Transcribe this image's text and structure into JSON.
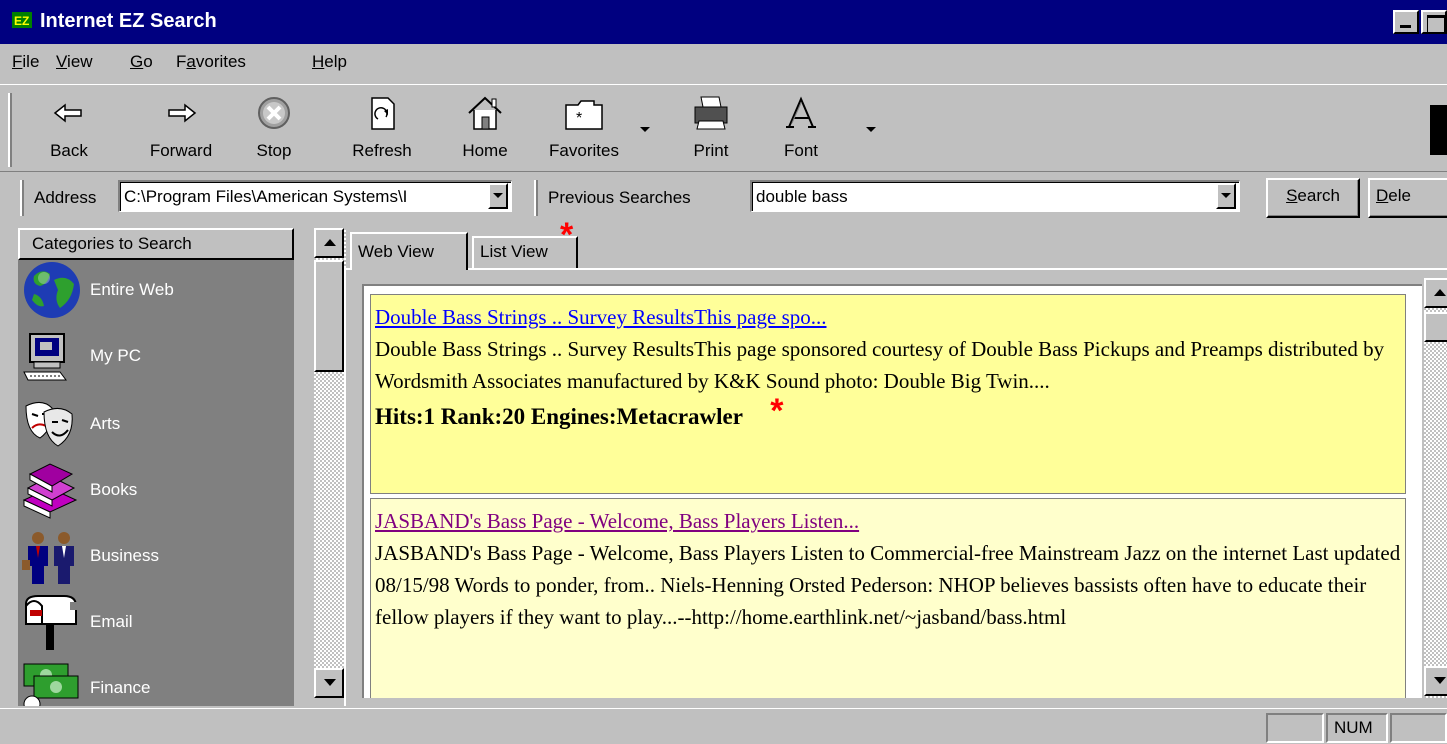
{
  "window": {
    "title": "Internet EZ Search",
    "icon": "ez-logo-icon"
  },
  "menu": {
    "items": [
      {
        "label": "File",
        "accel": "F"
      },
      {
        "label": "View",
        "accel": "V"
      },
      {
        "label": "Go",
        "accel": "G"
      },
      {
        "label": "Favorites",
        "accel": "a"
      },
      {
        "label": "Help",
        "accel": "H"
      }
    ]
  },
  "toolbar": {
    "buttons": [
      {
        "label": "Back",
        "icon": "back-arrow-icon"
      },
      {
        "label": "Forward",
        "icon": "forward-arrow-icon"
      },
      {
        "label": "Stop",
        "icon": "stop-icon"
      },
      {
        "label": "Refresh",
        "icon": "refresh-icon"
      },
      {
        "label": "Home",
        "icon": "home-icon"
      },
      {
        "label": "Favorites",
        "icon": "favorites-folder-icon"
      },
      {
        "label": "Print",
        "icon": "printer-icon"
      },
      {
        "label": "Font",
        "icon": "font-icon"
      }
    ]
  },
  "address": {
    "label": "Address",
    "value": "C:\\Program Files\\American Systems\\I",
    "previous_label": "Previous Searches",
    "search_value": "double bass",
    "search_button": "Search",
    "delete_button": "Dele"
  },
  "categories": {
    "header": "Categories to Search",
    "items": [
      {
        "label": "Entire Web",
        "icon": "globe-icon"
      },
      {
        "label": "My PC",
        "icon": "computer-icon"
      },
      {
        "label": "Arts",
        "icon": "theater-masks-icon"
      },
      {
        "label": "Books",
        "icon": "books-icon"
      },
      {
        "label": "Business",
        "icon": "business-people-icon"
      },
      {
        "label": "Email",
        "icon": "mailbox-icon"
      },
      {
        "label": "Finance",
        "icon": "money-icon"
      }
    ]
  },
  "tabs": [
    {
      "label": "Web View"
    },
    {
      "label": "List View"
    }
  ],
  "results": [
    {
      "title": "Double Bass Strings .. Survey ResultsThis page spo...",
      "snippet": "Double Bass Strings .. Survey ResultsThis page sponsored courtesy of Double Bass Pickups and Preamps distributed by Wordsmith Associates manufactured by K&K Sound photo: Double Big Twin....",
      "hits": "Hits:1 Rank:20 Engines:Metacrawler",
      "bg": "#ffff99",
      "link_color": "#0000ff"
    },
    {
      "title": "JASBAND's Bass Page - Welcome, Bass Players Listen...",
      "snippet": "JASBAND's Bass Page - Welcome, Bass Players Listen to Commercial-free Mainstream Jazz on the internet Last updated 08/15/98 Words to ponder, from.. Niels-Henning Orsted Pederson: NHOP believes bassists often have to educate their fellow players if they want to play...--http://home.earthlink.net/~jasband/bass.html",
      "bg": "#ffffcc",
      "link_color": "#800080"
    }
  ],
  "annotation": {
    "mark": "*",
    "color": "#ff0000"
  },
  "status": {
    "num": "NUM"
  },
  "colors": {
    "titlebar": "#000080",
    "face": "#c0c0c0",
    "panel": "#808080"
  }
}
